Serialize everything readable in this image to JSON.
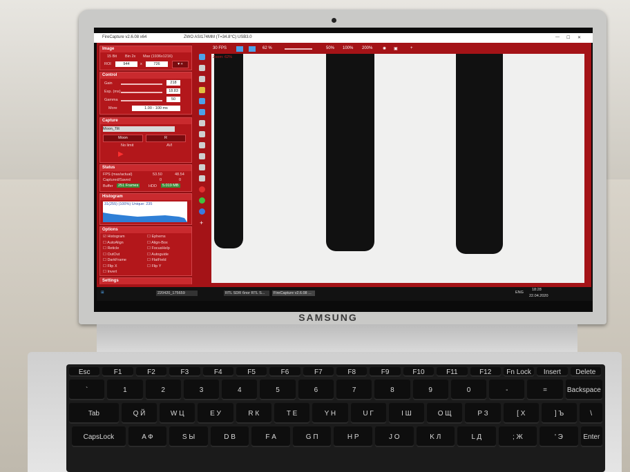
{
  "window": {
    "title": "FireCapture v2.6.08 x64",
    "camera": "ZWO ASI174MM (T=34.8°C) USB3.0"
  },
  "toolbar": {
    "fps": "30 FPS",
    "zoom_pct": "62 %",
    "z50": "50%",
    "z100": "100%",
    "z200": "200%"
  },
  "view": {
    "zoom_label": "Zoom: 62%"
  },
  "image": {
    "head": "Image",
    "bit": "15 Bit",
    "bin": "Bin 2x",
    "max": "Max (1936x1216)",
    "roi_label": "ROI",
    "roi_w": "944",
    "x": "x",
    "roi_h": "726"
  },
  "control": {
    "head": "Control",
    "gain_label": "Gain",
    "gain": "218",
    "exp_label": "Exp. (ms)",
    "exp": "18.83",
    "gamma_label": "Gamma",
    "gamma": "50",
    "more": "More",
    "range": "1.00 - 100 ms"
  },
  "capture": {
    "head": "Capture",
    "profile": "Moon_Tilt",
    "moon": "Moon",
    "r": "R",
    "nolimit": "No limit",
    "avi": "AVI"
  },
  "status": {
    "head": "Status",
    "fps_label": "FPS (max/actual)",
    "fps_max": "53.50",
    "fps_act": "48.54",
    "cap_label": "Captured/Saved",
    "cap": "0",
    "saved": "0",
    "buffer_label": "Buffer",
    "frames": "251 Frames",
    "hdd_label": "HDD",
    "hdd": "5.019 MB"
  },
  "histogram": {
    "head": "Histogram",
    "info": "31(255) (100%) Unique: 235"
  },
  "options": {
    "head": "Options",
    "left": [
      "Histogram",
      "AutoAlign",
      "Reticle",
      "OutOut",
      "DarkFrame",
      "Flip X",
      "Invert"
    ],
    "right": [
      "Ephems",
      "Align-Box",
      "FocusHelp",
      "Autoguide",
      "FlatField",
      "Flip Y"
    ]
  },
  "settings": {
    "head": "Settings",
    "author": "© Torsten Edelmann"
  },
  "taskbar": {
    "folder": "220420_175659",
    "chrome": "RTL SDR блог RTL S...",
    "fc": "FireCapture v2.6.08 ...",
    "lang": "ENG",
    "time": "18:28",
    "date": "22.04.2020"
  },
  "laptop": {
    "brand": "SAMSUNG"
  },
  "keys": {
    "row1": [
      "Esc",
      "F1",
      "F2",
      "F3",
      "F4",
      "F5",
      "F6",
      "F7",
      "F8",
      "F9",
      "F10",
      "F11",
      "F12",
      "Fn Lock",
      "Insert",
      "Delete"
    ],
    "row2": [
      "`",
      "1",
      "2",
      "3",
      "4",
      "5",
      "6",
      "7",
      "8",
      "9",
      "0",
      "-",
      "=",
      "Backspace"
    ],
    "row3": [
      "Tab",
      "Q Й",
      "W Ц",
      "E У",
      "R К",
      "T Е",
      "Y Н",
      "U Г",
      "I Ш",
      "O Щ",
      "P З",
      "[ Х",
      "] Ъ",
      "\\"
    ],
    "row4": [
      "CapsLock",
      "A Ф",
      "S Ы",
      "D В",
      "F А",
      "G П",
      "H Р",
      "J О",
      "K Л",
      "L Д",
      "; Ж",
      "' Э",
      "Enter"
    ]
  },
  "colors": {
    "app_red": "#a41317",
    "panel_red": "#8e0f12",
    "histo_blue": "#2f7fd6"
  }
}
